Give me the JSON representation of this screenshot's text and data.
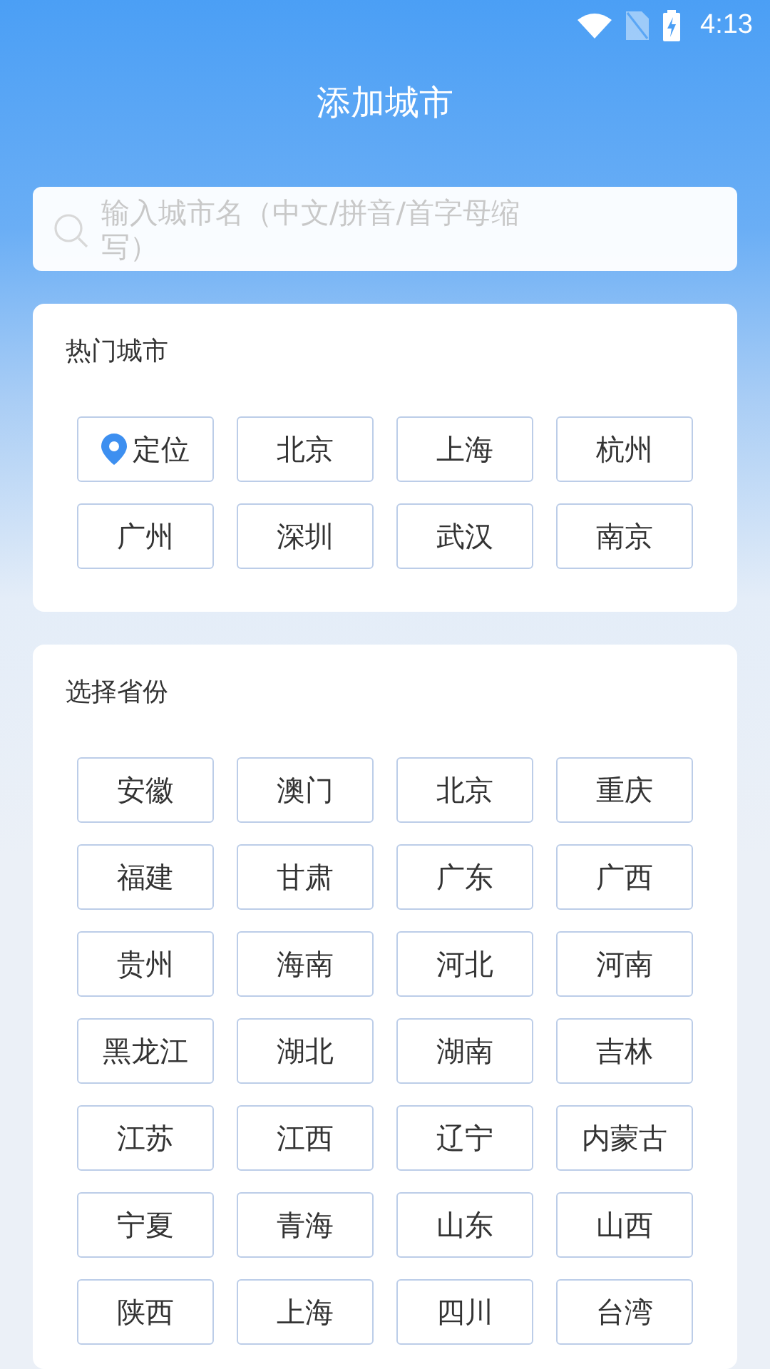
{
  "status_bar": {
    "time": "4:13"
  },
  "title": "添加城市",
  "search": {
    "placeholder": "输入城市名（中文/拼音/首字母缩写）"
  },
  "hot_cities": {
    "title": "热门城市",
    "items": [
      {
        "label": "定位",
        "kind": "location"
      },
      {
        "label": "北京",
        "kind": "city"
      },
      {
        "label": "上海",
        "kind": "city"
      },
      {
        "label": "杭州",
        "kind": "city"
      },
      {
        "label": "广州",
        "kind": "city"
      },
      {
        "label": "深圳",
        "kind": "city"
      },
      {
        "label": "武汉",
        "kind": "city"
      },
      {
        "label": "南京",
        "kind": "city"
      }
    ]
  },
  "provinces": {
    "title": "选择省份",
    "items": [
      "安徽",
      "澳门",
      "北京",
      "重庆",
      "福建",
      "甘肃",
      "广东",
      "广西",
      "贵州",
      "海南",
      "河北",
      "河南",
      "黑龙江",
      "湖北",
      "湖南",
      "吉林",
      "江苏",
      "江西",
      "辽宁",
      "内蒙古",
      "宁夏",
      "青海",
      "山东",
      "山西",
      "陕西",
      "上海",
      "四川",
      "台湾"
    ]
  }
}
